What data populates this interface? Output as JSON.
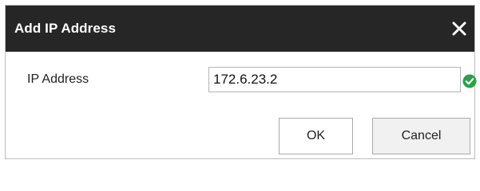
{
  "dialog": {
    "title": "Add IP Address",
    "close_icon": "close-icon"
  },
  "form": {
    "ip_label": "IP Address",
    "ip_value": "172.6.23.2",
    "valid_icon": "check-circle-icon",
    "valid_color": "#2e9e4a"
  },
  "buttons": {
    "ok_label": "OK",
    "cancel_label": "Cancel"
  }
}
